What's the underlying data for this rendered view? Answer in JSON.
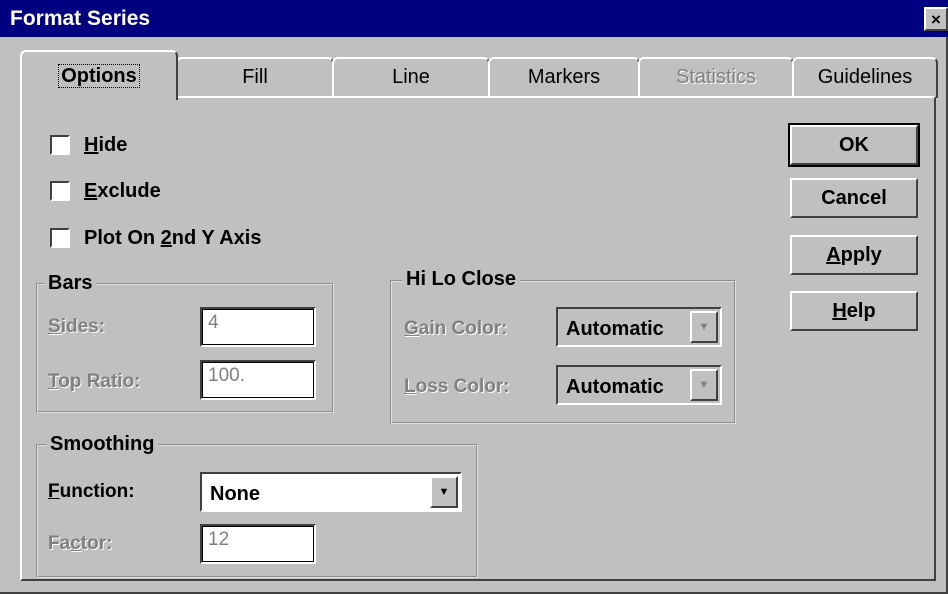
{
  "window": {
    "title": "Format Series",
    "close_symbol": "×"
  },
  "tabs": [
    {
      "label": "Options",
      "active": true,
      "enabled": true
    },
    {
      "label": "Fill",
      "active": false,
      "enabled": true
    },
    {
      "label": "Line",
      "active": false,
      "enabled": true
    },
    {
      "label": "Markers",
      "active": false,
      "enabled": true
    },
    {
      "label": "Statistics",
      "active": false,
      "enabled": false
    },
    {
      "label": "Guidelines",
      "active": false,
      "enabled": true
    }
  ],
  "options": {
    "hide": {
      "pre": "",
      "key": "H",
      "post": "ide",
      "checked": false
    },
    "exclude": {
      "pre": "",
      "key": "E",
      "post": "xclude",
      "checked": false
    },
    "plot_2nd_y": {
      "pre": "Plot On ",
      "key": "2",
      "post": "nd Y Axis",
      "checked": false
    }
  },
  "bars": {
    "title": "Bars",
    "sides_label": {
      "pre": "",
      "key": "S",
      "post": "ides:"
    },
    "sides_value": "4",
    "top_ratio_label": {
      "pre": "",
      "key": "T",
      "post": "op Ratio:"
    },
    "top_ratio_value": "100."
  },
  "hilo": {
    "title": "Hi Lo Close",
    "gain_label": {
      "pre": "",
      "key": "G",
      "post": "ain Color:"
    },
    "gain_value": "Automatic",
    "loss_label": {
      "pre": "",
      "key": "L",
      "post": "oss Color:"
    },
    "loss_value": "Automatic"
  },
  "smoothing": {
    "title": "Smoothing",
    "function_label": {
      "pre": "",
      "key": "F",
      "post": "unction:"
    },
    "function_value": "None",
    "factor_label": {
      "pre": "Fa",
      "key": "c",
      "post": "tor:"
    },
    "factor_value": "12"
  },
  "buttons": {
    "ok": {
      "pre": "OK",
      "key": "",
      "post": ""
    },
    "cancel": {
      "pre": "Cancel",
      "key": "",
      "post": ""
    },
    "apply": {
      "pre": "",
      "key": "A",
      "post": "pply"
    },
    "help": {
      "pre": "",
      "key": "H",
      "post": "elp"
    }
  },
  "icons": {
    "dropdown": "▼"
  }
}
